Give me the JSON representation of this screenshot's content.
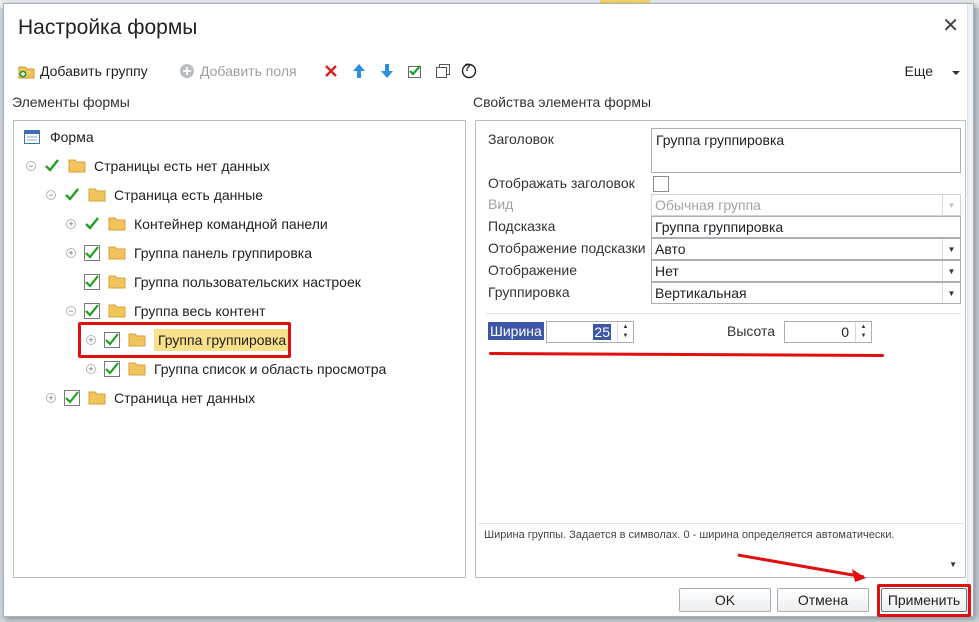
{
  "dialog": {
    "title": "Настройка формы",
    "close_glyph": "✕"
  },
  "toolbar": {
    "add_group_label": "Добавить группу",
    "add_fields_label": "Добавить поля",
    "more_label": "Еще",
    "help_glyph": "?"
  },
  "left_section_title": "Элементы формы",
  "right_section_title": "Свойства элемента формы",
  "tree": {
    "root_label": "Форма",
    "items": [
      {
        "label": "Страницы есть нет данных"
      },
      {
        "label": "Страница есть данные"
      },
      {
        "label": "Контейнер командной панели"
      },
      {
        "label": "Группа панель группировка"
      },
      {
        "label": "Группа пользовательских настроек"
      },
      {
        "label": "Группа весь контент"
      },
      {
        "label": "Группа группировка"
      },
      {
        "label": "Группа список и область просмотра"
      },
      {
        "label": "Страница нет данных"
      }
    ]
  },
  "props": {
    "header_label": "Заголовок",
    "header_value": "Группа группировка",
    "show_header_label": "Отображать заголовок",
    "view_label": "Вид",
    "view_value": "Обычная группа",
    "tooltip_label": "Подсказка",
    "tooltip_value": "Группа группировка",
    "tooltip_display_label": "Отображение подсказки",
    "tooltip_display_value": "Авто",
    "display_label": "Отображение",
    "display_value": "Нет",
    "grouping_label": "Группировка",
    "grouping_value": "Вертикальная",
    "width_label": "Ширина",
    "width_value": "25",
    "height_label": "Высота",
    "height_value": "0",
    "hint_text": "Ширина группы. Задается в символах. 0 - ширина определяется автоматически."
  },
  "buttons": {
    "ok": "OK",
    "cancel": "Отмена",
    "apply": "Применить"
  },
  "colors": {
    "check_green": "#1fa01f",
    "folder_yellow": "#f2c55c",
    "highlight_blue": "#3d56a6",
    "selection_yellow": "#f9e08a",
    "annotation_red": "#e01010"
  }
}
